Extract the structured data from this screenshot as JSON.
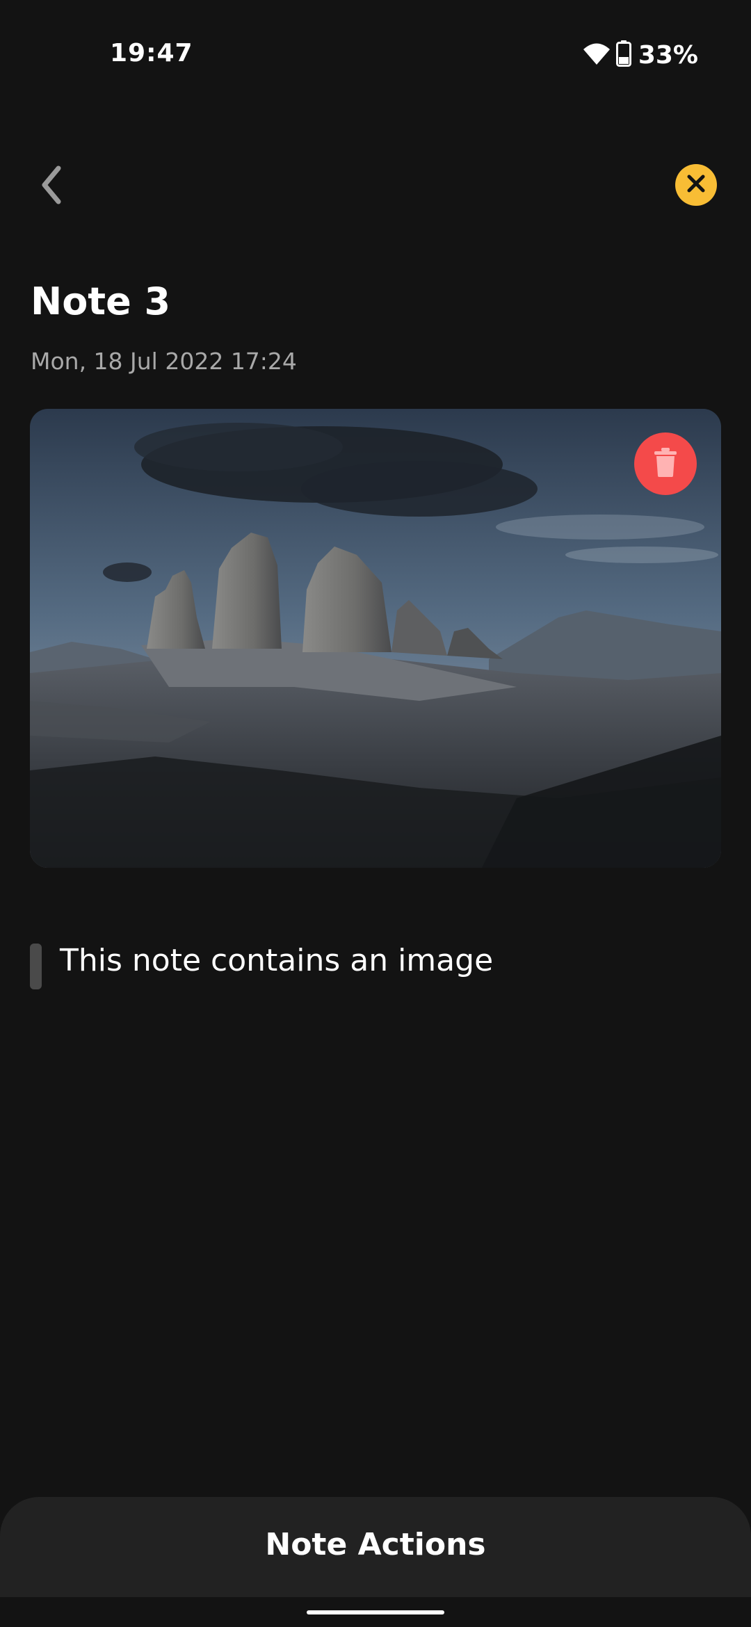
{
  "status_bar": {
    "time": "19:47",
    "battery": "33%"
  },
  "toolbar": {
    "back_icon": "chevron-left-icon",
    "close_icon": "close-icon",
    "close_color": "#f8bd35"
  },
  "note": {
    "title": "Note 3",
    "date": "Mon, 18 Jul 2022 17:24",
    "subtitle": "This note contains an image",
    "delete_icon": "trash-icon",
    "delete_color": "#f44a4a"
  },
  "bottom_sheet": {
    "title": "Note Actions"
  }
}
